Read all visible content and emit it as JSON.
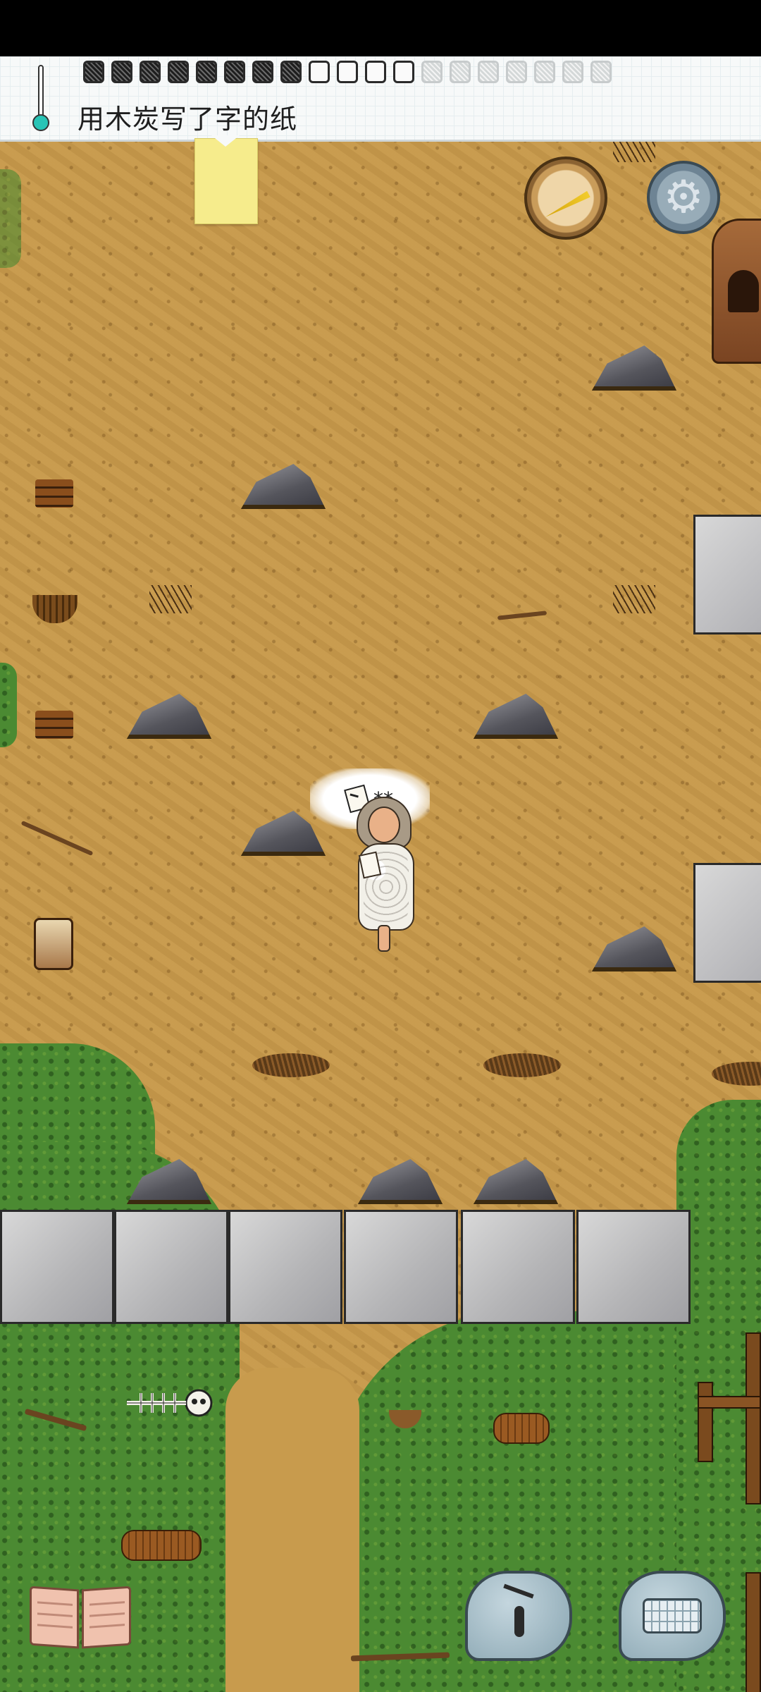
{
  "hud": {
    "held_item_text": "用木炭写了字的纸",
    "food": {
      "filled": 8,
      "empty": 4,
      "faint": 7
    },
    "temperature_icon": "thermometer-icon",
    "temperature_color": "#28c4b6"
  },
  "speech": {
    "text": "**",
    "icon": "paper-note-icon"
  },
  "controls": {
    "compass_icon": "compass-icon",
    "settings_icon": "gear-icon",
    "settings_glyph": "⚙",
    "book_icon": "open-book-icon",
    "emote_icon": "puppet-emote-icon",
    "keyboard_icon": "keyboard-icon"
  },
  "colors": {
    "dirt": "#c89b4d",
    "grass": "#4b8a32",
    "stone": "#b4b4b6",
    "sticky_note": "#f6ec8c"
  }
}
